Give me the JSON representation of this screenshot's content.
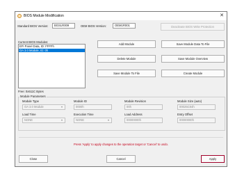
{
  "window": {
    "title": "BIOS Module Modification",
    "close_glyph": "✕"
  },
  "versions": {
    "standard_label": "Standard BIOS Version:",
    "standard_value": "BGSLR009",
    "oem_label": "OEM BIOS Version:",
    "oem_value": "OEM1R001",
    "deactivate_button": "Deactivate BIOS Write Protection"
  },
  "modules": {
    "label": "Current BIOS Modules:",
    "items": [
      {
        "text": "EFI Panel Data, ID: FFFFh",
        "selected": false
      },
      {
        "text": "OA 3.0 Module, ID: 0h",
        "selected": true
      }
    ],
    "free_text": "Free: 0x511C Bytes"
  },
  "actions": {
    "add_module": "Add Module",
    "save_module_data": "Save Module Data To File",
    "delete_module": "Delete Module",
    "save_module_overview": "Save Module Overview",
    "save_module_to_file": "Save Module To File",
    "create_module": "Create Module"
  },
  "params": {
    "group_label": "Module Parameters",
    "module_type_label": "Module Type",
    "module_type_value": "OA 3.0 Module",
    "module_id_label": "Module ID",
    "module_id_value": "0000h",
    "module_revision_label": "Module Revision",
    "module_revision_value": "00h",
    "module_size_label": "Module Size (auto)",
    "module_size_value": "00025C84h",
    "load_time_label": "Load Time",
    "load_time_value": "NONE",
    "execution_time_label": "Execution Time",
    "execution_time_value": "NONE",
    "load_address_label": "Load Address",
    "load_address_value": "00000000h",
    "entry_offset_label": "Entry Offset",
    "entry_offset_value": "00000000h"
  },
  "status": {
    "message": "Press 'Apply' to apply changes to the operation target or 'Cancel' to undo."
  },
  "footer": {
    "close": "Close",
    "cancel": "Cancel",
    "apply": "Apply"
  },
  "colors": {
    "accent": "#0078d7",
    "warning_text": "#c4001a",
    "apply_border": "#a0002a"
  }
}
